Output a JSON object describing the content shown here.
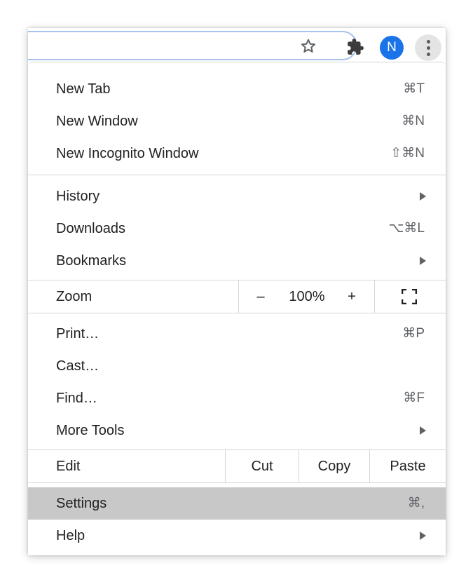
{
  "toolbar": {
    "avatar_letter": "N"
  },
  "menu": {
    "group1": [
      {
        "label": "New Tab",
        "shortcut": "⌘T"
      },
      {
        "label": "New Window",
        "shortcut": "⌘N"
      },
      {
        "label": "New Incognito Window",
        "shortcut": "⇧⌘N"
      }
    ],
    "group2": [
      {
        "label": "History",
        "shortcut": ""
      },
      {
        "label": "Downloads",
        "shortcut": "⌥⌘L"
      },
      {
        "label": "Bookmarks",
        "shortcut": ""
      }
    ],
    "zoom": {
      "label": "Zoom",
      "minus": "–",
      "value": "100%",
      "plus": "+"
    },
    "group3": [
      {
        "label": "Print…",
        "shortcut": "⌘P"
      },
      {
        "label": "Cast…",
        "shortcut": ""
      },
      {
        "label": "Find…",
        "shortcut": "⌘F"
      },
      {
        "label": "More Tools",
        "shortcut": ""
      }
    ],
    "edit": {
      "label": "Edit",
      "cut": "Cut",
      "copy": "Copy",
      "paste": "Paste"
    },
    "group4": [
      {
        "label": "Settings",
        "shortcut": "⌘,"
      },
      {
        "label": "Help",
        "shortcut": ""
      }
    ]
  },
  "icons": {
    "star": "star-icon",
    "extensions": "puzzle-icon",
    "more": "more-vertical-icon",
    "fullscreen": "fullscreen-icon",
    "submenu": "chevron-right-icon"
  },
  "colors": {
    "avatar": "#1a73e8",
    "highlight": "#c8c8c8",
    "omnibox_border": "#a7c3ec"
  }
}
